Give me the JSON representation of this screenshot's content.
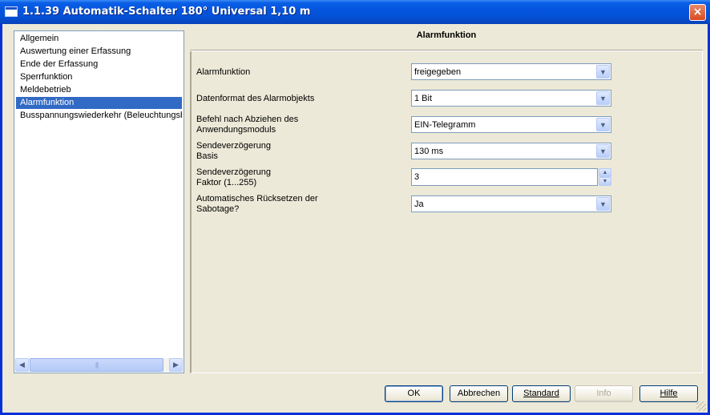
{
  "window": {
    "title": "1.1.39 Automatik-Schalter 180° Universal 1,10 m",
    "close_label": "×"
  },
  "tree": {
    "items": [
      {
        "label": "Allgemein",
        "selected": false
      },
      {
        "label": "Auswertung einer Erfassung",
        "selected": false
      },
      {
        "label": "Ende der Erfassung",
        "selected": false
      },
      {
        "label": "Sperrfunktion",
        "selected": false
      },
      {
        "label": "Meldebetrieb",
        "selected": false
      },
      {
        "label": "Alarmfunktion",
        "selected": true
      },
      {
        "label": "Busspannungswiederkehr (Beleuchtungsbe",
        "selected": false
      }
    ],
    "scroll_left": "◀",
    "scroll_right": "▶",
    "scroll_thumb": "|||"
  },
  "panel": {
    "title": "Alarmfunktion",
    "params": [
      {
        "label_lines": [
          "Alarmfunktion"
        ],
        "type": "select",
        "value": "freigegeben"
      },
      {
        "label_lines": [
          "Datenformat des Alarmobjekts"
        ],
        "type": "select",
        "value": "1 Bit"
      },
      {
        "label_lines": [
          "Befehl nach Abziehen des",
          "Anwendungsmoduls"
        ],
        "type": "select",
        "value": "EIN-Telegramm"
      },
      {
        "label_lines": [
          "Sendeverzögerung",
          "Basis"
        ],
        "type": "select",
        "value": "130 ms"
      },
      {
        "label_lines": [
          "Sendeverzögerung",
          "Faktor (1...255)"
        ],
        "type": "spin",
        "value": "3"
      },
      {
        "label_lines": [
          "Automatisches Rücksetzen der",
          "Sabotage?"
        ],
        "type": "select",
        "value": "Ja"
      }
    ],
    "dropdown_arrow": "▼",
    "spin_up": "▲",
    "spin_down": "▼"
  },
  "buttons": {
    "ok": "OK",
    "cancel": "Abbrechen",
    "standard": "Standard",
    "info": "Info",
    "help": "Hilfe"
  },
  "colors": {
    "titlebar": "#0655de",
    "selection": "#316ac5",
    "dialog_bg": "#ece9d8"
  }
}
